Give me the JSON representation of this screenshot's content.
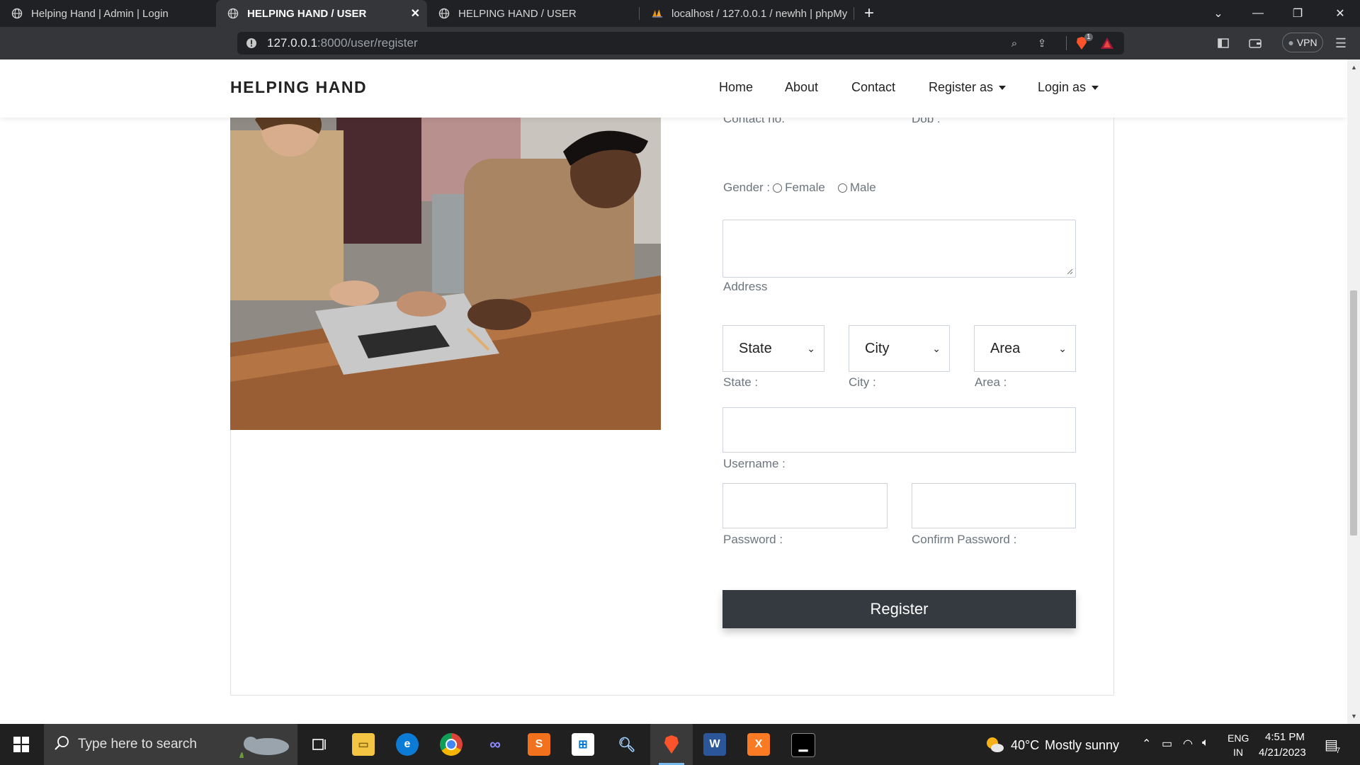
{
  "browser": {
    "tabs": [
      {
        "title": "Helping Hand | Admin | Login",
        "active": false
      },
      {
        "title": "HELPING HAND / USER",
        "active": true
      },
      {
        "title": "HELPING HAND / USER",
        "active": false
      },
      {
        "title": "localhost / 127.0.0.1 / newhh | phpMy",
        "active": false
      }
    ],
    "url_host": "127.0.0.1",
    "url_rest": ":8000/user/register",
    "vpn_label": "VPN",
    "shield_badge": "1"
  },
  "navbar": {
    "brand": "HELPING HAND",
    "items": [
      "Home",
      "About",
      "Contact"
    ],
    "register_as": "Register as",
    "login_as": "Login as"
  },
  "form": {
    "contact_label": "Contact no.",
    "dob_label": "Dob :",
    "gender_label": "Gender :",
    "gender_options": [
      "Female",
      "Male"
    ],
    "address_label": "Address",
    "state_select": "State",
    "city_select": "City",
    "area_select": "Area",
    "state_label": "State :",
    "city_label": "City :",
    "area_label": "Area :",
    "username_label": "Username :",
    "password_label": "Password :",
    "confirm_password_label": "Confirm Password :",
    "register_button": "Register"
  },
  "taskbar": {
    "search_placeholder": "Type here to search",
    "weather_temp": "40°C",
    "weather_text": "Mostly sunny",
    "lang_1": "ENG",
    "lang_2": "IN",
    "time": "4:51 PM",
    "date": "4/21/2023",
    "notification_count": "7"
  },
  "colors": {
    "button_dark": "#343a40",
    "label_gray": "#6c757d",
    "chrome_dark": "#202124"
  }
}
